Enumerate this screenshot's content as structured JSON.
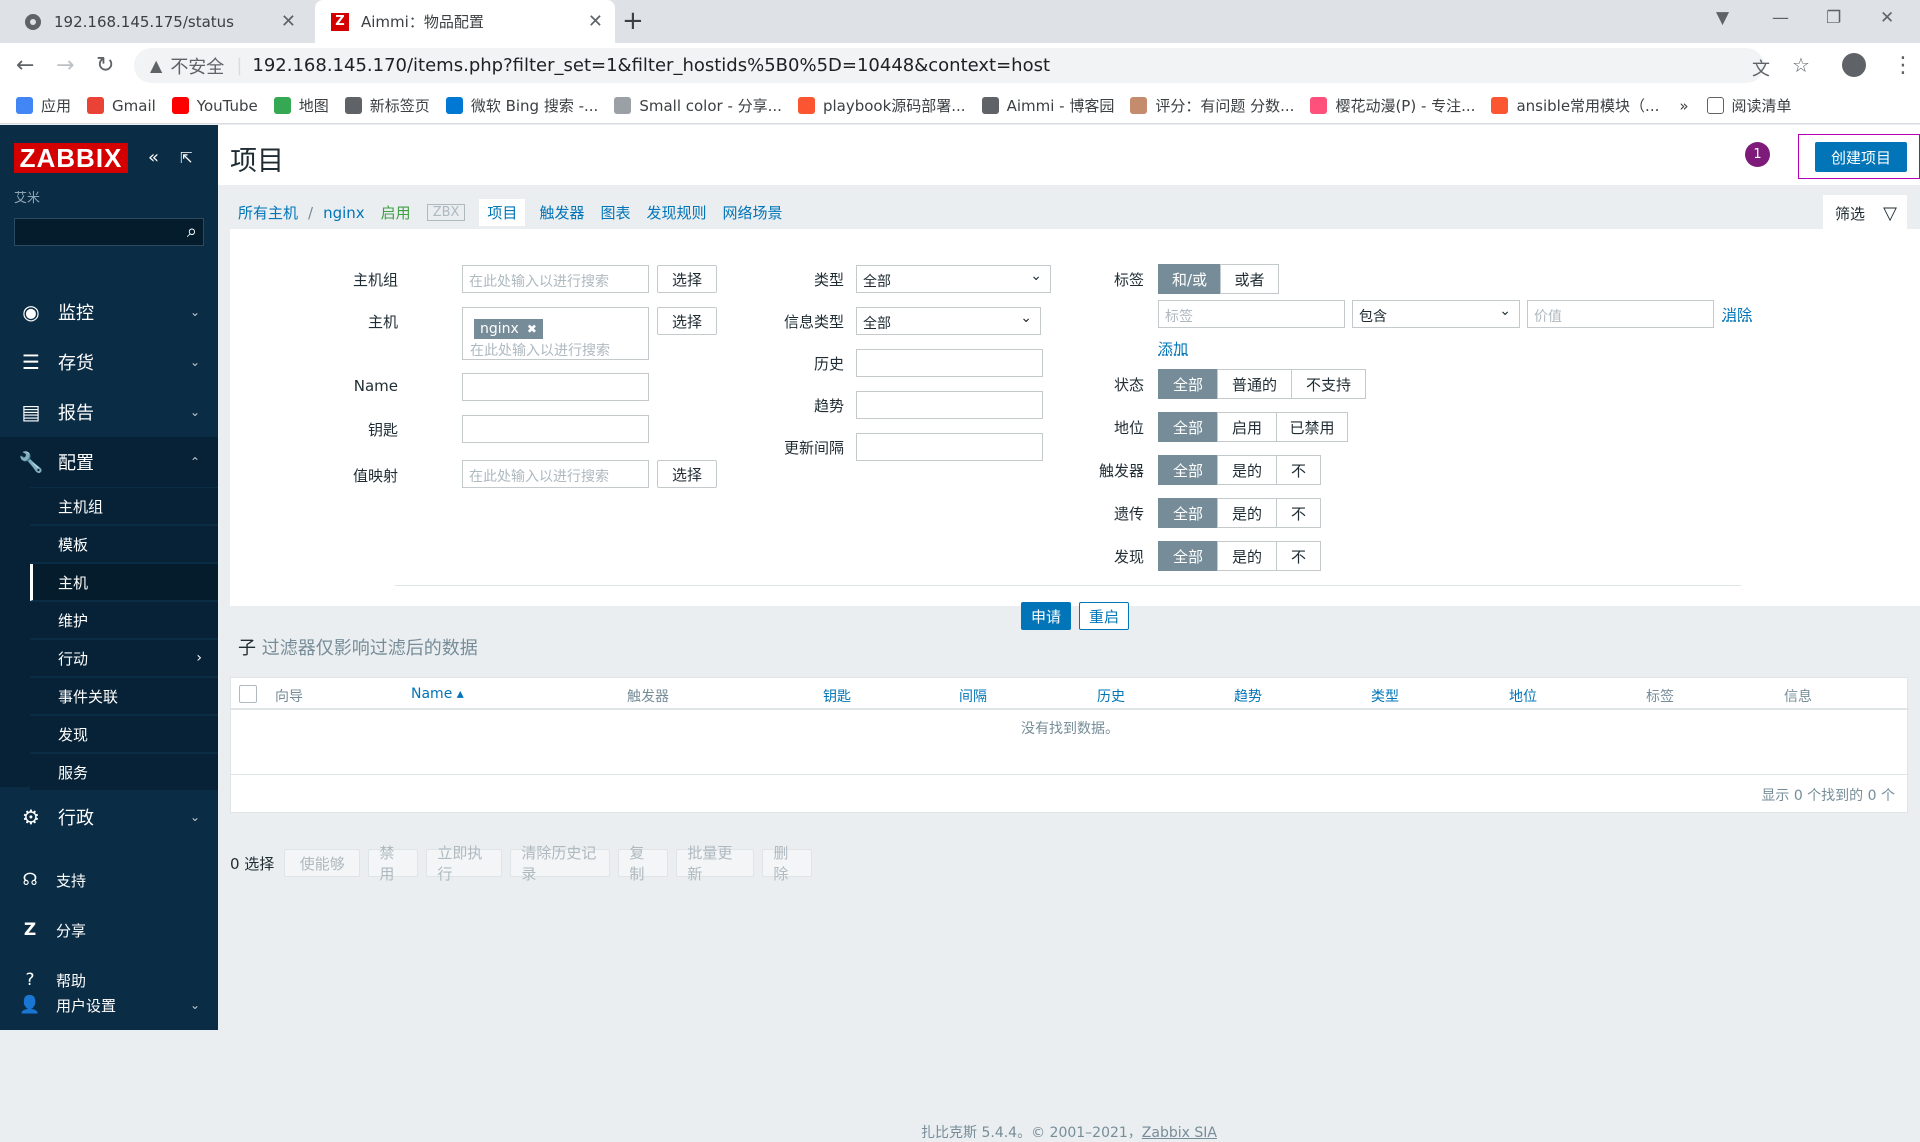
{
  "browser": {
    "tabs": [
      {
        "title": "192.168.145.175/status",
        "favicon": "globe-icon"
      },
      {
        "title": "Aimmi：物品配置",
        "favicon": "zabbix-z-icon"
      }
    ],
    "security_label": "不安全",
    "url": "192.168.145.170/items.php?filter_set=1&filter_hostids%5B0%5D=10448&context=host",
    "bookmarks": [
      {
        "label": "应用",
        "icon": "apps-grid-icon",
        "color": "#4285f4"
      },
      {
        "label": "Gmail",
        "icon": "gmail-icon",
        "color": "#ea4335"
      },
      {
        "label": "YouTube",
        "icon": "youtube-icon",
        "color": "#ff0000"
      },
      {
        "label": "地图",
        "icon": "maps-icon",
        "color": "#34a853"
      },
      {
        "label": "新标签页",
        "icon": "globe-icon",
        "color": "#5f6368"
      },
      {
        "label": "微软 Bing 搜索 -...",
        "icon": "bing-icon",
        "color": "#0078d4"
      },
      {
        "label": "Small color - 分享...",
        "icon": "avatar-icon",
        "color": "#9aa0a6"
      },
      {
        "label": "playbook源码部署...",
        "icon": "csdn-icon",
        "color": "#fc5531"
      },
      {
        "label": "Aimmi - 博客园",
        "icon": "cnblogs-icon",
        "color": "#5f6368"
      },
      {
        "label": "评分：有问题 分数...",
        "icon": "avatar-icon",
        "color": "#c58b6d"
      },
      {
        "label": "樱花动漫(P) - 专注...",
        "icon": "flower-icon",
        "color": "#ff4f7b"
      },
      {
        "label": "ansible常用模块（...",
        "icon": "csdn-icon",
        "color": "#fc5531"
      }
    ],
    "bookmarks_more": "»",
    "reading_list": "阅读清单"
  },
  "sidebar": {
    "logo": "ZABBIX",
    "subtitle": "艾米",
    "menu": [
      {
        "label": "监控",
        "icon": "eye-icon"
      },
      {
        "label": "存货",
        "icon": "list-icon"
      },
      {
        "label": "报告",
        "icon": "bar-chart-icon"
      },
      {
        "label": "配置",
        "icon": "wrench-icon"
      }
    ],
    "submenu": [
      "主机组",
      "模板",
      "主机",
      "维护",
      "行动",
      "事件关联",
      "发现",
      "服务"
    ],
    "admin": {
      "label": "行政",
      "icon": "gear-icon"
    },
    "bottom": [
      {
        "label": "支持",
        "icon": "headset-icon"
      },
      {
        "label": "分享",
        "icon": "share-z-icon"
      },
      {
        "label": "帮助",
        "icon": "question-icon"
      },
      {
        "label": "用户设置",
        "icon": "user-icon"
      }
    ]
  },
  "header": {
    "title": "项目",
    "notification_count": "1",
    "create_button": "创建项目"
  },
  "breadcrumbs": {
    "all_hosts": "所有主机",
    "sep": "/",
    "host": "nginx",
    "status": "启用",
    "zbx": "ZBX",
    "tabs": [
      "项目",
      "触发器",
      "图表",
      "发现规则",
      "网络场景"
    ]
  },
  "filter": {
    "tab_label": "筛选",
    "host_group_label": "主机组",
    "host_label": "主机",
    "name_label": "Name",
    "key_label": "钥匙",
    "value_map_label": "值映射",
    "search_placeholder": "在此处输入以进行搜索",
    "select_button": "选择",
    "host_chip": "nginx",
    "type_label": "类型",
    "type_value": "全部",
    "info_type_label": "信息类型",
    "info_type_value": "全部",
    "history_label": "历史",
    "trend_label": "趋势",
    "interval_label": "更新间隔",
    "tags_label": "标签",
    "tag_mode": [
      "和/或",
      "或者"
    ],
    "tag_placeholder": "标签",
    "tag_operator": "包含",
    "value_placeholder": "价值",
    "remove_link": "消除",
    "add_link": "添加",
    "state_label": "状态",
    "state_options": [
      "全部",
      "普通的",
      "不支持"
    ],
    "status_label": "地位",
    "status_options": [
      "全部",
      "启用",
      "已禁用"
    ],
    "triggers_label": "触发器",
    "inherited_label": "遗传",
    "discovered_label": "发现",
    "yesno_options": [
      "全部",
      "是的",
      "不"
    ],
    "apply": "申请",
    "reset": "重启"
  },
  "subfilter": {
    "heading": "子",
    "text": "过滤器仅影响过滤后的数据"
  },
  "table": {
    "columns": [
      "向导",
      "Name ▴",
      "触发器",
      "钥匙",
      "间隔",
      "历史",
      "趋势",
      "类型",
      "地位",
      "标签",
      "信息"
    ],
    "empty": "没有找到数据。",
    "paging": "显示 0 个找到的 0 个"
  },
  "actions": {
    "selected": "0 选择",
    "buttons": [
      "使能够",
      "禁用",
      "立即执行",
      "清除历史记录",
      "复制",
      "批量更新",
      "删除"
    ]
  },
  "footer": {
    "text": "扎比克斯 5.4.4。© 2001–2021，",
    "link": "Zabbix SIA"
  }
}
